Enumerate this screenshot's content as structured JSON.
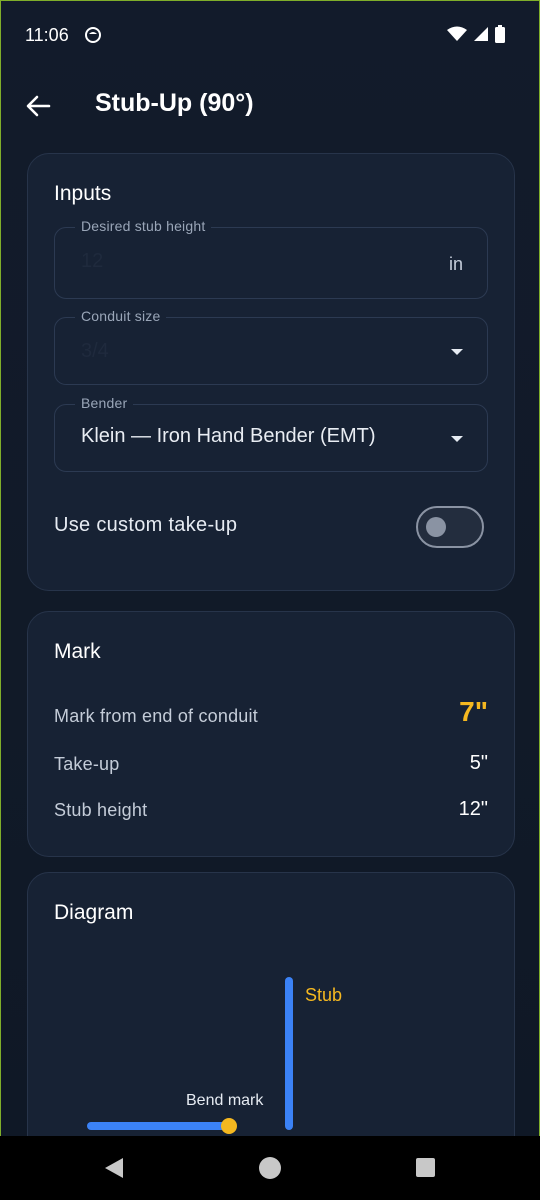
{
  "status": {
    "time": "11:06"
  },
  "appbar": {
    "title": "Stub-Up (90°)"
  },
  "inputs": {
    "title": "Inputs",
    "stub_height": {
      "label": "Desired stub height",
      "value": "12",
      "unit": "in"
    },
    "conduit_size": {
      "label": "Conduit size",
      "value": "3/4"
    },
    "bender": {
      "label": "Bender",
      "value": "Klein — Iron Hand Bender (EMT)"
    },
    "custom_takeup": {
      "label": "Use custom take-up",
      "on": false
    }
  },
  "mark": {
    "title": "Mark",
    "rows": [
      {
        "label": "Mark from end of conduit",
        "value": "7\""
      },
      {
        "label": "Take-up",
        "value": "5\""
      },
      {
        "label": "Stub height",
        "value": "12\""
      }
    ]
  },
  "diagram": {
    "title": "Diagram",
    "stub_label": "Stub",
    "bend_label": "Bend mark"
  },
  "colors": {
    "accent": "#f5b820",
    "conduit": "#3b82f6",
    "background": "#0f1724",
    "card": "#172234"
  }
}
